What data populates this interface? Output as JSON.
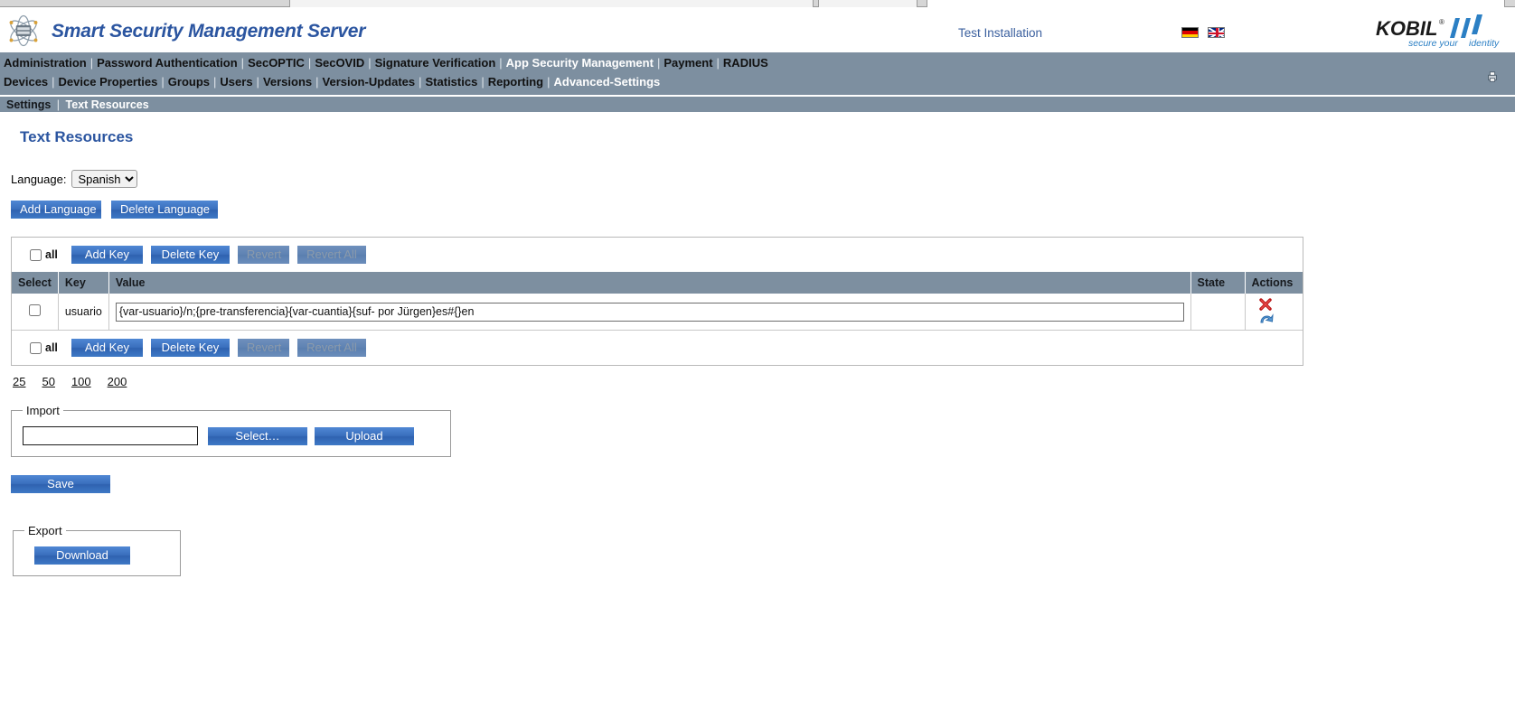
{
  "header": {
    "app_title": "Smart Security Management Server",
    "test_installation": "Test Installation",
    "logo_text": "KOBIL",
    "logo_tagline_a": "secure your",
    "logo_tagline_b": "identity",
    "logo_registered": "®",
    "flags": [
      {
        "name": "flag-de",
        "label": "Deutsch"
      },
      {
        "name": "flag-gb",
        "label": "English"
      }
    ]
  },
  "nav": {
    "row1": [
      {
        "label": "Administration",
        "active": false
      },
      {
        "label": "Password Authentication",
        "active": false
      },
      {
        "label": "SecOPTIC",
        "active": false
      },
      {
        "label": "SecOVID",
        "active": false
      },
      {
        "label": "Signature Verification",
        "active": false
      },
      {
        "label": "App Security Management",
        "active": true
      },
      {
        "label": "Payment",
        "active": false
      },
      {
        "label": "RADIUS",
        "active": false
      }
    ],
    "row2": [
      {
        "label": "Devices",
        "active": false
      },
      {
        "label": "Device Properties",
        "active": false
      },
      {
        "label": "Groups",
        "active": false
      },
      {
        "label": "Users",
        "active": false
      },
      {
        "label": "Versions",
        "active": false
      },
      {
        "label": "Version-Updates",
        "active": false
      },
      {
        "label": "Statistics",
        "active": false
      },
      {
        "label": "Reporting",
        "active": false
      },
      {
        "label": "Advanced-Settings",
        "active": true
      }
    ],
    "separator": "|"
  },
  "breadcrumb": {
    "parent": "Settings",
    "separator": "|",
    "current": "Text Resources"
  },
  "page": {
    "title": "Text Resources"
  },
  "language": {
    "label": "Language:",
    "selected": "Spanish",
    "options": [
      "Spanish"
    ],
    "add_button": "Add Language",
    "delete_button": "Delete Language"
  },
  "toolbar": {
    "all_label": "all",
    "add_key": "Add Key",
    "delete_key": "Delete Key",
    "revert": "Revert",
    "revert_all": "Revert All"
  },
  "table": {
    "columns": [
      "Select",
      "Key",
      "Value",
      "State",
      "Actions"
    ],
    "rows": [
      {
        "selected": false,
        "key": "usuario",
        "value": "{var-usuario}/n;{pre-transferencia}{var-cuantia}{suf- por Jürgen}es#{}en",
        "state": "",
        "actions": [
          "delete-icon",
          "revert-icon"
        ]
      }
    ]
  },
  "pagination": {
    "options": [
      "25",
      "50",
      "100",
      "200"
    ]
  },
  "import": {
    "legend": "Import",
    "file_value": "",
    "select_button": "Select…",
    "upload_button": "Upload"
  },
  "save": {
    "label": "Save"
  },
  "export": {
    "legend": "Export",
    "download_button": "Download"
  },
  "colors": {
    "nav_bar": "#7d8fa0",
    "accent_blue": "#2b55a0",
    "button_blue": "#3a6fbd",
    "delete_red": "#cc2222",
    "revert_blue": "#2f6fae"
  }
}
